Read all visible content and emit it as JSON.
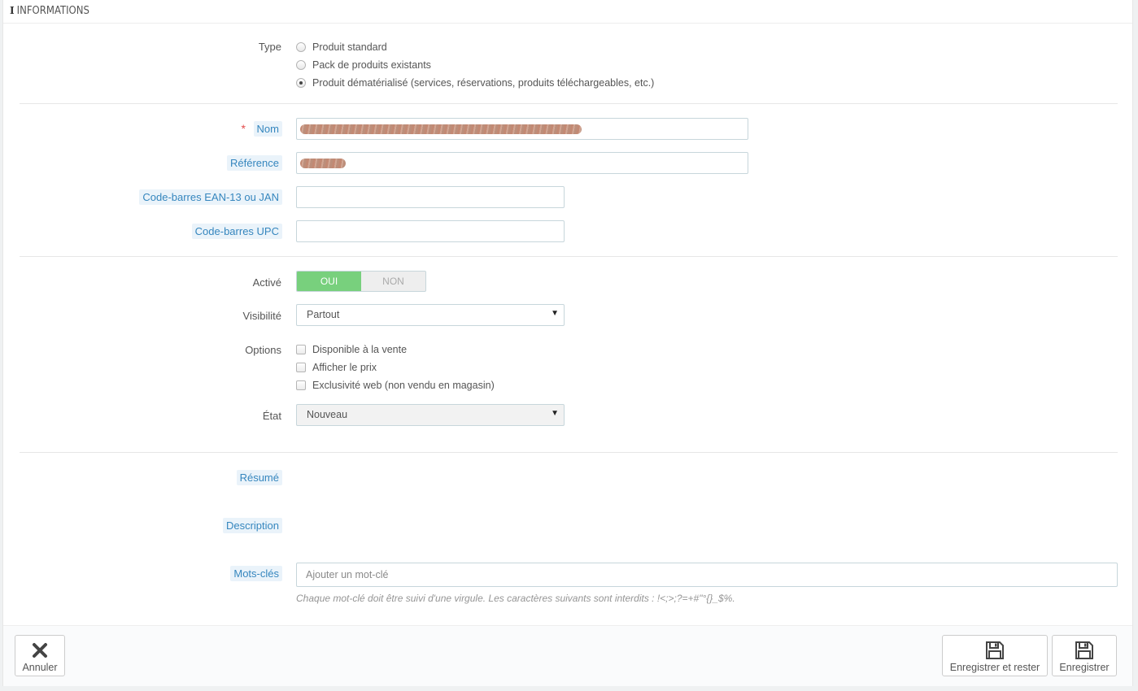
{
  "panel": {
    "heading_icon": "i",
    "heading": "Informations"
  },
  "type": {
    "label": "Type",
    "options": [
      {
        "label": "Produit standard",
        "checked": false
      },
      {
        "label": "Pack de produits existants",
        "checked": false
      },
      {
        "label": "Produit dématérialisé (services, réservations, produits téléchargeables, etc.)",
        "checked": true
      }
    ]
  },
  "fields": {
    "required_mark": "*",
    "name_label": "Nom",
    "reference_label": "Référence",
    "ean_label": "Code-barres EAN-13 ou JAN",
    "ean_value": "",
    "upc_label": "Code-barres UPC",
    "upc_value": ""
  },
  "active": {
    "label": "Activé",
    "on": "OUI",
    "off": "NON",
    "value": true
  },
  "visibility": {
    "label": "Visibilité",
    "value": "Partout"
  },
  "options": {
    "label": "Options",
    "items": [
      {
        "label": "Disponible à la vente",
        "checked": false
      },
      {
        "label": "Afficher le prix",
        "checked": false
      },
      {
        "label": "Exclusivité web (non vendu en magasin)",
        "checked": false
      }
    ]
  },
  "condition": {
    "label": "État",
    "value": "Nouveau"
  },
  "summary": {
    "label": "Résumé"
  },
  "description": {
    "label": "Description"
  },
  "keywords": {
    "label": "Mots-clés",
    "placeholder": "Ajouter un mot-clé",
    "help": "Chaque mot-clé doit être suivi d'une virgule. Les caractères suivants sont interdits : !<;>;?=+#\"°{}_$%."
  },
  "footer": {
    "cancel": "Annuler",
    "save_stay": "Enregistrer et rester",
    "save": "Enregistrer"
  },
  "colors": {
    "accent": "#3586be",
    "switch_on": "#78d07d",
    "required": "#e24c4c"
  }
}
